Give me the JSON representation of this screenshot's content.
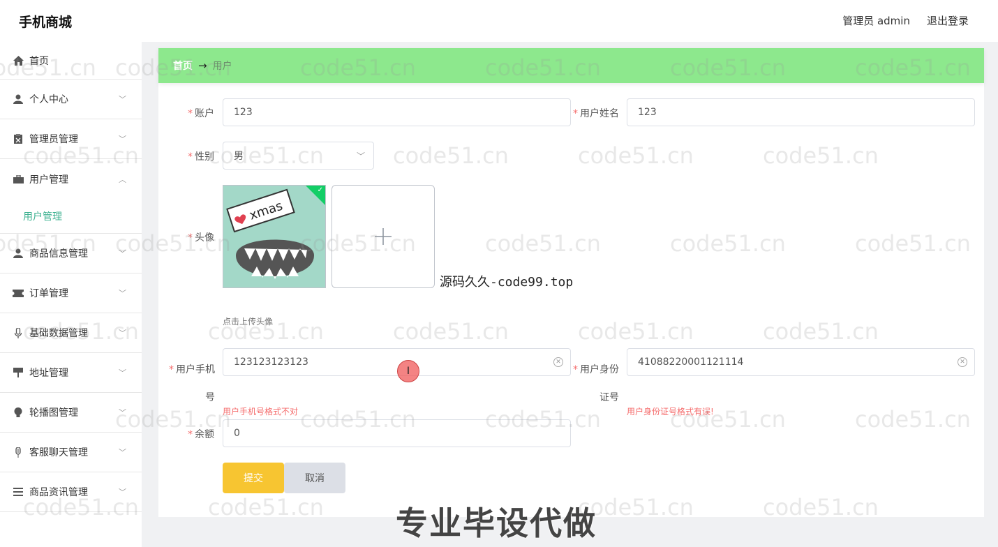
{
  "app": {
    "title": "手机商城"
  },
  "header": {
    "admin_label": "管理员 admin",
    "logout_label": "退出登录"
  },
  "sidebar": {
    "items": [
      {
        "label": "首页",
        "icon": "home-icon"
      },
      {
        "label": "个人中心",
        "icon": "user-icon"
      },
      {
        "label": "管理员管理",
        "icon": "clipboard-icon"
      },
      {
        "label": "用户管理",
        "icon": "briefcase-icon",
        "expanded": true
      },
      {
        "label": "商品信息管理",
        "icon": "person-icon"
      },
      {
        "label": "订单管理",
        "icon": "ticket-icon"
      },
      {
        "label": "基础数据管理",
        "icon": "microphone-icon"
      },
      {
        "label": "地址管理",
        "icon": "sign-icon"
      },
      {
        "label": "轮播图管理",
        "icon": "bulb-icon"
      },
      {
        "label": "客服聊天管理",
        "icon": "mic-icon"
      },
      {
        "label": "商品资讯管理",
        "icon": "list-icon"
      }
    ],
    "submenu": {
      "label": "用户管理"
    }
  },
  "breadcrumb": {
    "home": "首页",
    "arrow": "→",
    "current": "用户"
  },
  "form": {
    "account": {
      "label": "账户",
      "value": "123"
    },
    "username": {
      "label": "用户姓名",
      "value": "123"
    },
    "gender": {
      "label": "性别",
      "value": "男"
    },
    "avatar": {
      "label": "头像",
      "tip": "点击上传头像",
      "image_text": "xmas"
    },
    "phone": {
      "label_line1": "用户手机",
      "label_line2": "号",
      "value": "123123123123",
      "error": "用户手机号格式不对"
    },
    "idcard": {
      "label_line1": "用户身份",
      "label_line2": "证号",
      "value": "41088220001121114",
      "error": "用户身份证号格式有误!"
    },
    "balance": {
      "label": "余额",
      "value": "0"
    },
    "submit_label": "提交",
    "cancel_label": "取消"
  },
  "overlay": {
    "site_text": "源码久久-code99.top",
    "banner": "专业毕设代做",
    "watermark": "code51.cn",
    "cursor_glyph": "I"
  },
  "colors": {
    "breadcrumb_bg": "#8de88d",
    "submit_bg": "#f7c531",
    "active_menu": "#3bb08f",
    "error": "#f56c6c"
  }
}
